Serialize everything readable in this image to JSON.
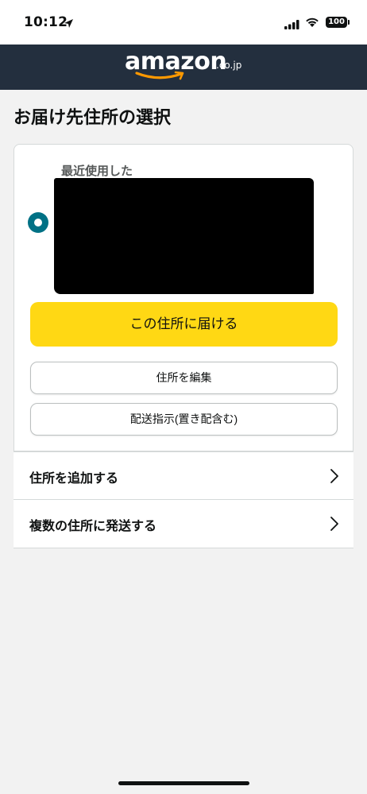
{
  "status_bar": {
    "time": "10:12",
    "battery": "100"
  },
  "header": {
    "logo_text": "amazon",
    "logo_suffix": ".co.jp"
  },
  "page": {
    "title": "お届け先住所の選択"
  },
  "address_card": {
    "recent_label": "最近使用した",
    "selected": true,
    "primary_button": "この住所に届ける",
    "edit_button": "住所を編集",
    "delivery_button": "配送指示(置き配含む)"
  },
  "options": [
    {
      "label": "住所を追加する",
      "icon": "chevron-right-icon"
    },
    {
      "label": "複数の住所に発送する",
      "icon": "chevron-right-icon"
    }
  ],
  "colors": {
    "header_bg": "#232f3e",
    "primary_button": "#ffd814",
    "radio_selected": "#007185",
    "smile": "#ff9900",
    "page_bg": "#f2f2f2"
  }
}
